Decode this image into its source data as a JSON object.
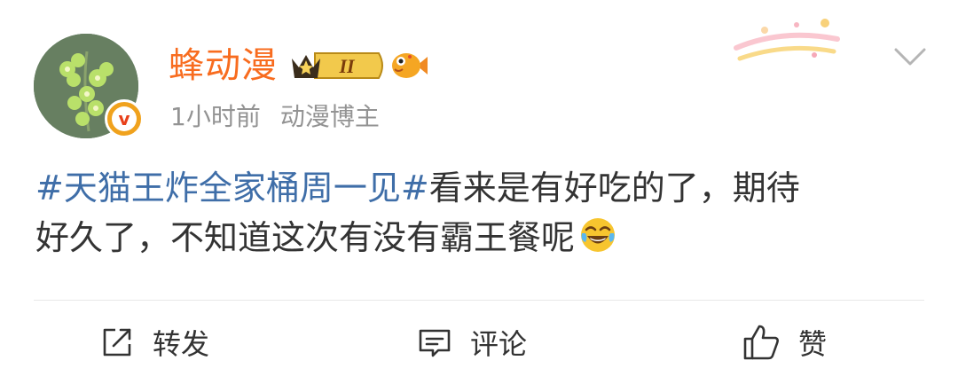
{
  "post": {
    "username": "蜂动漫",
    "vip_level": "II",
    "time": "1小时前",
    "source": "动漫博主",
    "content": {
      "hashtag": "#天猫王炸全家桶周一见#",
      "line1_rest": "看来是有好吃的了，期待",
      "line2": "好久了，不知道这次有没有霸王餐呢",
      "emoji": "laugh-cry-emoji"
    }
  },
  "actions": {
    "repost": "转发",
    "comment": "评论",
    "like": "赞"
  },
  "colors": {
    "username": "#f86c1f",
    "hashtag": "#3f6ea8",
    "meta": "#939393",
    "verified_badge": "#f0a21d"
  },
  "icons": [
    "verified-badge-icon",
    "vip-crown-badge-icon",
    "fish-badge-icon",
    "chevron-down-icon",
    "repost-icon",
    "comment-icon",
    "like-icon"
  ]
}
